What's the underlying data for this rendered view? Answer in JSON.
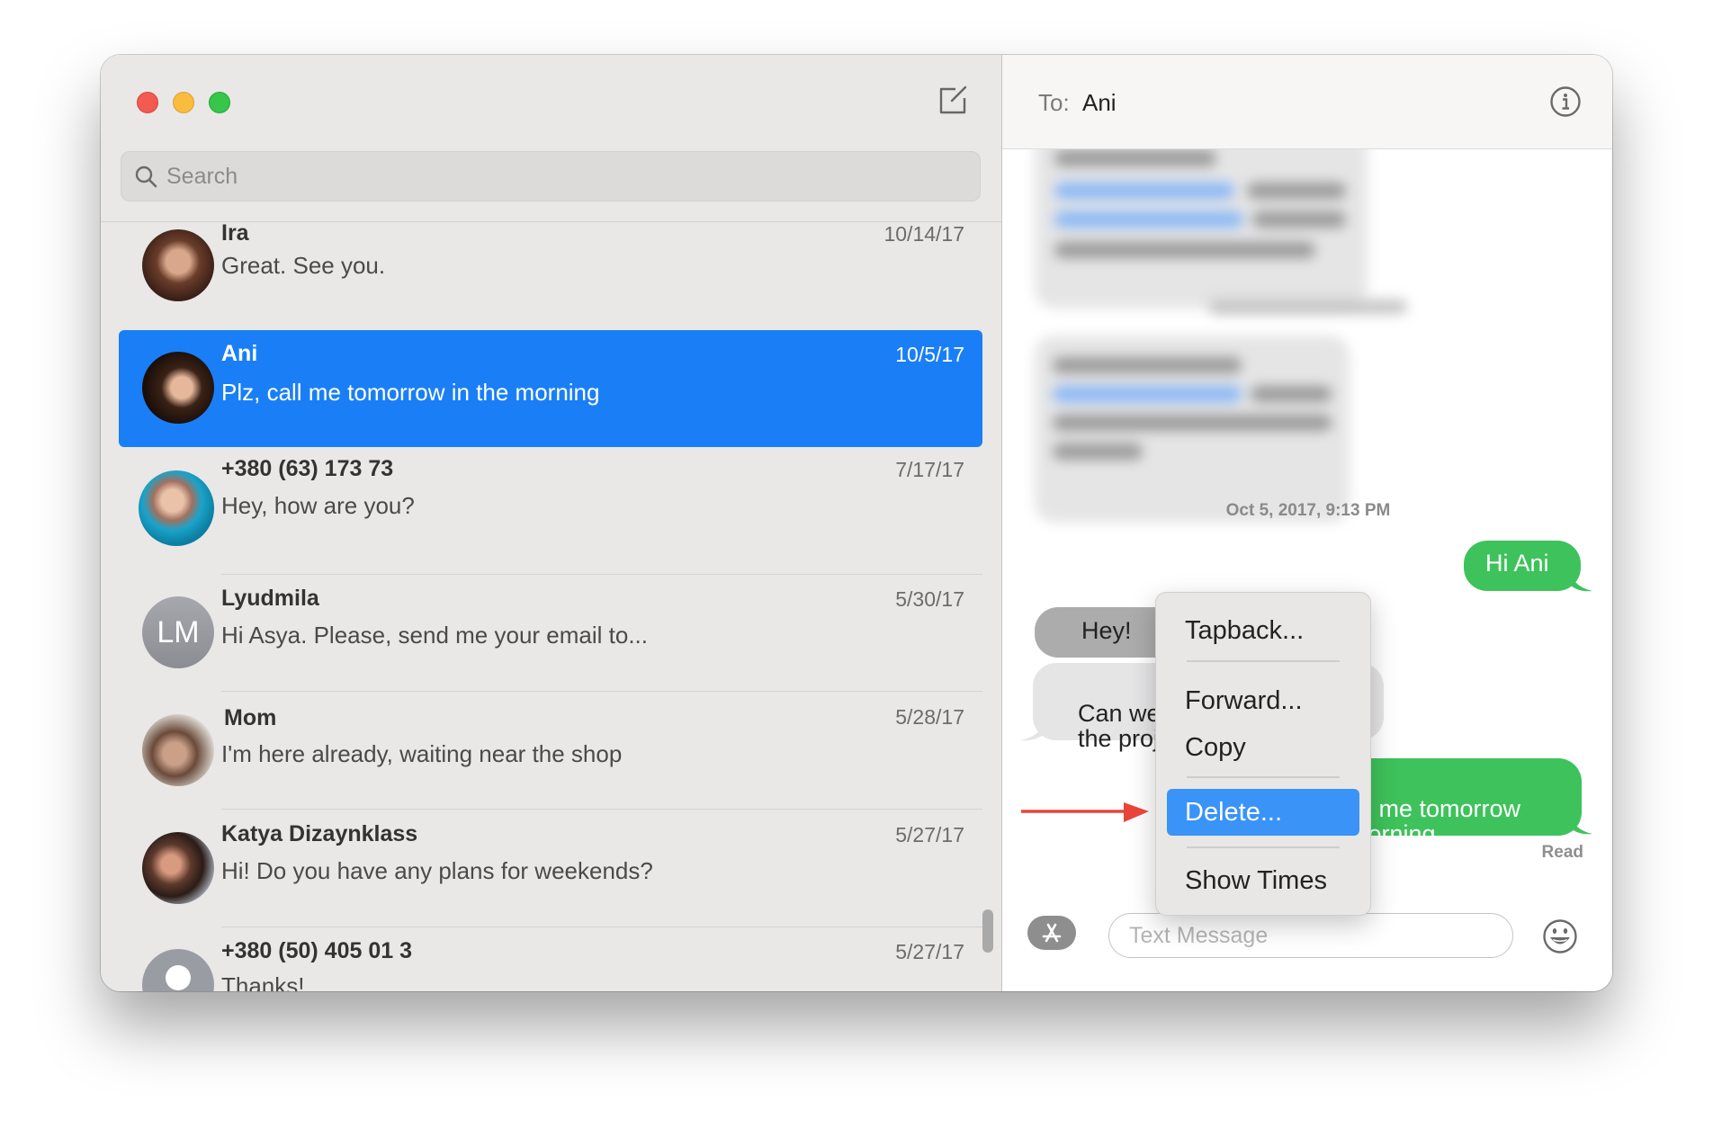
{
  "window": {
    "traffic_lights": [
      "close",
      "minimize",
      "zoom"
    ]
  },
  "sidebar": {
    "compose_icon": "compose-icon",
    "search": {
      "placeholder": "Search",
      "value": ""
    },
    "conversations": [
      {
        "name": "Ira",
        "date": "10/14/17",
        "preview": "Great. See you.",
        "avatar": "photo",
        "selected": false
      },
      {
        "name": "Ani",
        "date": "10/5/17",
        "preview": "Plz, call me tomorrow in the morning",
        "avatar": "photo",
        "selected": true
      },
      {
        "name": "+380 (63) 173 73",
        "date": "7/17/17",
        "preview": "Hey, how are you?",
        "avatar": "photo",
        "selected": false
      },
      {
        "name": "Lyudmila",
        "date": "5/30/17",
        "preview": "Hi Asya. Please, send me your email to...",
        "avatar": "LM",
        "selected": false
      },
      {
        "name": "Mom",
        "date": "5/28/17",
        "preview": "I'm here already, waiting near the shop",
        "avatar": "photo",
        "selected": false
      },
      {
        "name": "Katya Dizaynklass",
        "date": "5/27/17",
        "preview": "Hi! Do you have any plans for weekends?",
        "avatar": "photo",
        "selected": false
      },
      {
        "name": "+380 (50) 405 01 3",
        "date": "5/27/17",
        "preview": "Thanks!",
        "avatar": "placeholder-person",
        "selected": false
      }
    ]
  },
  "conversation": {
    "to_label": "To:",
    "recipient": "Ani",
    "info_icon": "info-icon",
    "timestamp": "Oct 5, 2017, 9:13 PM",
    "messages": [
      {
        "direction": "out",
        "text": "Hi Ani"
      },
      {
        "direction": "in",
        "text": "Hey!"
      },
      {
        "direction": "in",
        "text": "Can we\nthe proj"
      },
      {
        "direction": "out",
        "text": "all me tomorrow\nmorning"
      }
    ],
    "read_receipt": "Read",
    "composer": {
      "placeholder": "Text Message",
      "value": ""
    }
  },
  "context_menu": {
    "items": [
      {
        "label": "Tapback...",
        "highlighted": false
      },
      {
        "label": "Forward...",
        "highlighted": false
      },
      {
        "label": "Copy",
        "highlighted": false
      },
      {
        "label": "Delete...",
        "highlighted": true
      },
      {
        "label": "Show Times",
        "highlighted": false
      }
    ]
  },
  "annotation": {
    "arrow_color": "#e8443a",
    "points_to": "Delete..."
  },
  "colors": {
    "selection_blue": "#1a7ff6",
    "sent_green": "#3ec25b",
    "menu_highlight": "#3a93f7"
  }
}
